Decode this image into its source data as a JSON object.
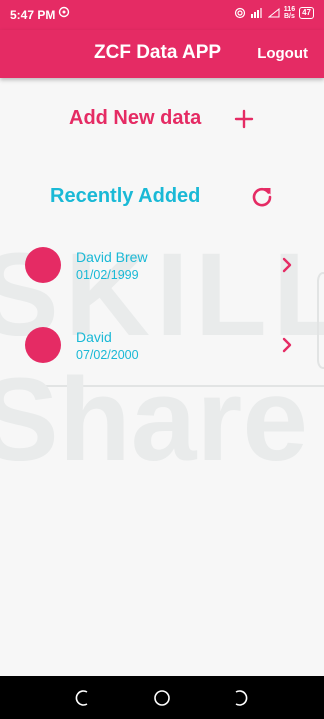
{
  "status_bar": {
    "time": "5:47 PM",
    "net_speed_value": "116",
    "net_speed_unit": "B/s",
    "battery": "47"
  },
  "app_bar": {
    "title": "ZCF Data APP",
    "logout_label": "Logout"
  },
  "add_section": {
    "label": "Add New data"
  },
  "recent_section": {
    "label": "Recently Added"
  },
  "items": [
    {
      "name": "David Brew",
      "date": "01/02/1999"
    },
    {
      "name": "David",
      "date": "07/02/2000"
    }
  ],
  "colors": {
    "primary": "#e52b64",
    "accent": "#1ab9d6",
    "background": "#f7f7f7"
  },
  "watermark": {
    "line1": "SKILL",
    "line2": "Share"
  },
  "icons": {
    "add": "plus-icon",
    "refresh": "refresh-icon",
    "item_open": "chevron-right-icon",
    "nav_recent": "recent-apps-icon",
    "nav_home": "home-icon",
    "nav_back": "back-icon"
  }
}
